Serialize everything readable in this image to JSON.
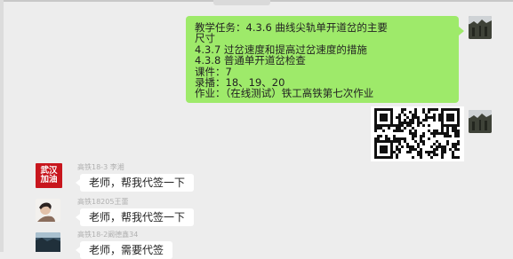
{
  "window": {
    "title": ""
  },
  "messages": {
    "outgoing_text": {
      "lines": [
        "教学任务：4.3.6 曲线尖轨单开道岔的主要",
        "尺寸",
        "4.3.7 过岔速度和提高过岔速度的措施",
        "4.3.8 普通单开道岔检查",
        "课件：7",
        "录播：18、19、20",
        "作业：（在线测试）铁工高铁第七次作业"
      ]
    },
    "incoming": [
      {
        "sender": "高铁18-3 李湘",
        "text": "老师，帮我代签一下",
        "avatar_text": [
          "武汉",
          "加油"
        ]
      },
      {
        "sender": "高铁18205王蕾",
        "text": "老师，帮我代签一下"
      },
      {
        "sender": "高铁18-2阚德鑫34",
        "text": "老师，需要代签"
      }
    ]
  },
  "colors": {
    "background": "#ededed",
    "outgoing_bubble": "#9eea6a",
    "incoming_bubble": "#ffffff",
    "wuhan_avatar": "#c8161d"
  },
  "icons": {
    "self_avatar": "photo-avatar-icon",
    "qr_code": "qr-code-icon"
  }
}
